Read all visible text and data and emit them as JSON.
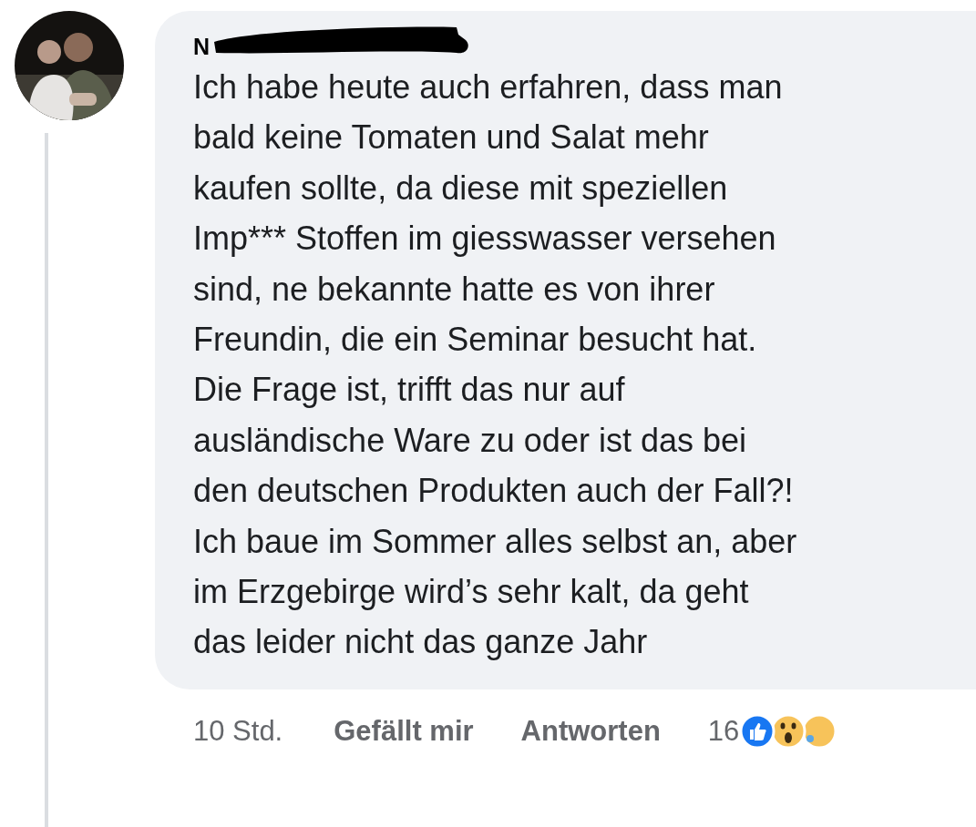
{
  "comment": {
    "avatar": {
      "kind": "picture"
    },
    "author": "N",
    "author_redacted": true,
    "lines": [
      "Ich habe heute auch erfahren, dass man",
      "bald keine Tomaten und Salat mehr",
      "kaufen sollte, da diese mit speziellen",
      "Imp*** Stoffen im giesswasser versehen",
      "sind, ne bekannte hatte es von ihrer",
      "Freundin, die ein Seminar besucht hat.",
      "Die Frage ist, trifft das nur auf",
      "ausländische Ware zu oder ist das bei",
      "den deutschen Produkten auch der Fall?!",
      "Ich baue im Sommer alles selbst an, aber",
      "im Erzgebirge wird’s sehr kalt, da geht",
      "das leider nicht das ganze Jahr"
    ],
    "time": "10 Std.",
    "actions": [
      "Gefällt mir",
      "Antworten"
    ],
    "reaction_count": "16",
    "reactions": [
      {
        "kind": "like"
      },
      {
        "kind": "wow"
      },
      {
        "kind": "sad"
      }
    ]
  }
}
